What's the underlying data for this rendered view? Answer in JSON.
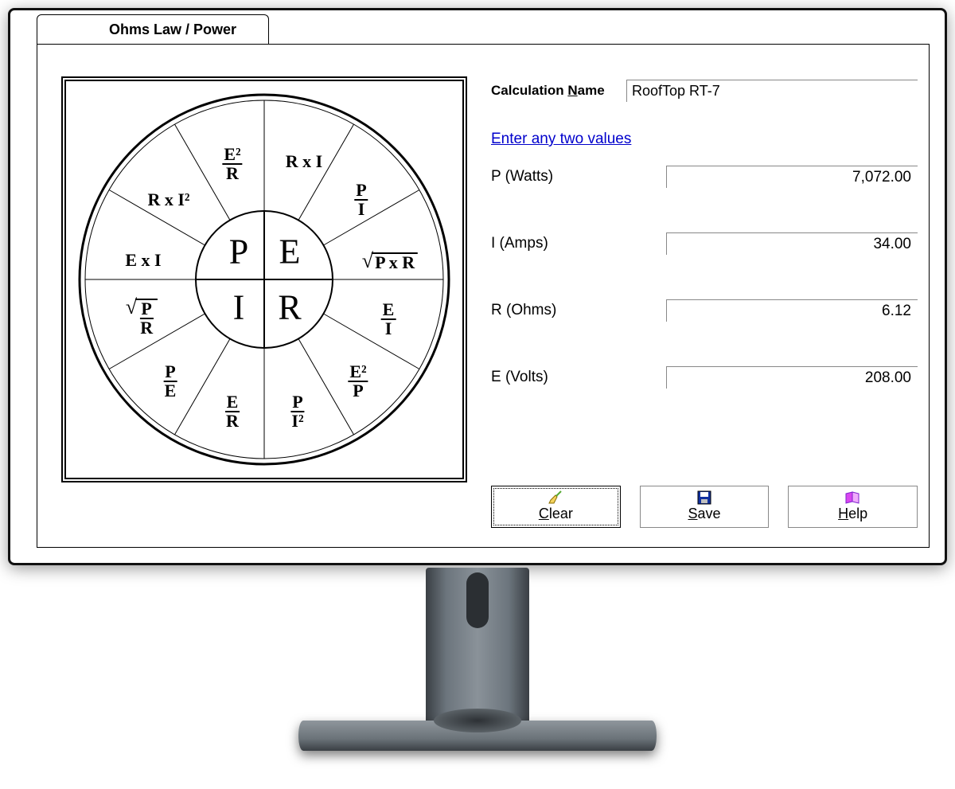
{
  "tab_title": "Ohms Law / Power",
  "calc_name_label_pre": "Calculation ",
  "calc_name_label_mn": "N",
  "calc_name_label_post": "ame",
  "calc_name_value": "RoofTop RT-7",
  "instruction": "Enter any two values",
  "fields": {
    "p": {
      "label": "P (Watts)",
      "value": "7,072.00"
    },
    "i": {
      "label": "I (Amps)",
      "value": "34.00"
    },
    "r": {
      "label": "R (Ohms)",
      "value": "6.12"
    },
    "e": {
      "label": "E (Volts)",
      "value": "208.00"
    }
  },
  "buttons": {
    "clear": {
      "mn": "C",
      "rest": "lear"
    },
    "save": {
      "mn": "S",
      "rest": "ave"
    },
    "help": {
      "mn": "H",
      "rest": "elp"
    }
  },
  "wheel_center": {
    "p": "P",
    "e": "E",
    "i": "I",
    "r": "R"
  },
  "wheel_formulas": {
    "e2_over_r": {
      "num": "E²",
      "den": "R"
    },
    "r_x_i": "R x I",
    "p_over_i": {
      "num": "P",
      "den": "I"
    },
    "r_x_i2": "R x I²",
    "sqrt_pxr": "P x R",
    "e_x_i": "E x I",
    "e_over_i": {
      "num": "E",
      "den": "I"
    },
    "sqrt_p_over_r": {
      "num": "P",
      "den": "R"
    },
    "e2_over_p": {
      "num": "E²",
      "den": "P"
    },
    "p_over_e": {
      "num": "P",
      "den": "E"
    },
    "p_over_i2": {
      "num": "P",
      "den": "I²"
    },
    "e_over_r": {
      "num": "E",
      "den": "R"
    }
  }
}
